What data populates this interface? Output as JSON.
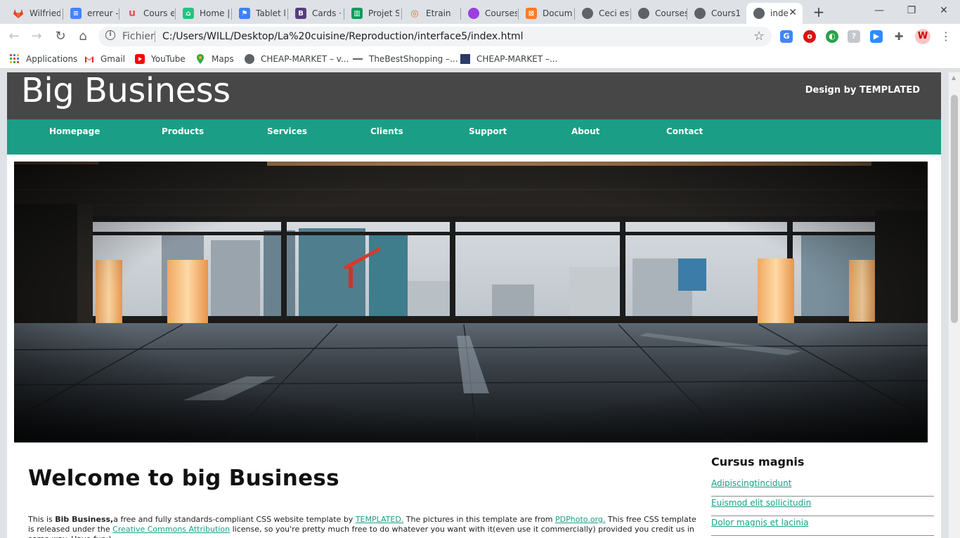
{
  "browser": {
    "tabs": [
      {
        "label": "Wilfried",
        "icon": "gitlab-icon",
        "color": "#e24329"
      },
      {
        "label": "erreur -",
        "icon": "google-docs-icon",
        "color": "#4285f4"
      },
      {
        "label": "Cours e",
        "icon": "udemy-icon",
        "color": "#ec5252"
      },
      {
        "label": "Home |",
        "icon": "home-app-icon",
        "color": "#26c281"
      },
      {
        "label": "Tablet l",
        "icon": "flag-icon",
        "color": "#3b82f6"
      },
      {
        "label": "Cards ·",
        "icon": "bootstrap-icon",
        "color": "#563d7c"
      },
      {
        "label": "Projet S",
        "icon": "trello-icon",
        "color": "#0b9a5a"
      },
      {
        "label": "Etrain",
        "icon": "etrain-icon",
        "color": "#f06529"
      },
      {
        "label": "Courses",
        "icon": "circle-icon",
        "color": "#9c3fe0"
      },
      {
        "label": "Docum",
        "icon": "xampp-icon",
        "color": "#fb7a24"
      },
      {
        "label": "Ceci est",
        "icon": "globe-icon",
        "color": "#5f6368"
      },
      {
        "label": "Courses",
        "icon": "globe-icon",
        "color": "#5f6368"
      },
      {
        "label": "Cours1",
        "icon": "globe-icon",
        "color": "#5f6368"
      },
      {
        "label": "inde",
        "icon": "globe-icon",
        "color": "#5f6368"
      }
    ],
    "address": {
      "scheme": "Fichier",
      "url": "C:/Users/WILL/Desktop/La%20cuisine/Reproduction/interface5/index.html"
    },
    "bookmarks": [
      {
        "label": "Applications",
        "icon": "apps-grid-icon"
      },
      {
        "label": "Gmail",
        "icon": "gmail-icon"
      },
      {
        "label": "YouTube",
        "icon": "youtube-icon"
      },
      {
        "label": "Maps",
        "icon": "maps-pin-icon"
      },
      {
        "label": "CHEAP-MARKET – v...",
        "icon": "globe-icon"
      },
      {
        "label": "TheBestShopping –...",
        "icon": "shopping-icon"
      },
      {
        "label": "CHEAP-MARKET –...",
        "icon": "market-icon"
      }
    ]
  },
  "site": {
    "logo": "Big Business",
    "credit": "Design by TEMPLATED",
    "menu": [
      "Homepage",
      "Products",
      "Services",
      "Clients",
      "Support",
      "About",
      "Contact"
    ],
    "heading": "Welcome to big Business",
    "intro": {
      "t1": "This is ",
      "brand": "Bib Business,",
      "t2": "a free and fully standards-compliant CSS website template by ",
      "link1": "TEMPLATED.",
      "t3": " The pictures in this template are from ",
      "link2": "PDPhoto.org.",
      "t4": " This free CSS template is released under the ",
      "link3": "Creative Commons Attribution",
      "t5": " license, so you're pretty much free to do whatever you want with it(even use it commercially) provided you credit us in some way. Have fun:)"
    },
    "sidebar": {
      "title": "Cursus magnis",
      "links": [
        "Adipiscingtincidunt",
        "Euismod elit sollicitudin",
        "Dolor magnis et lacinia"
      ]
    }
  }
}
